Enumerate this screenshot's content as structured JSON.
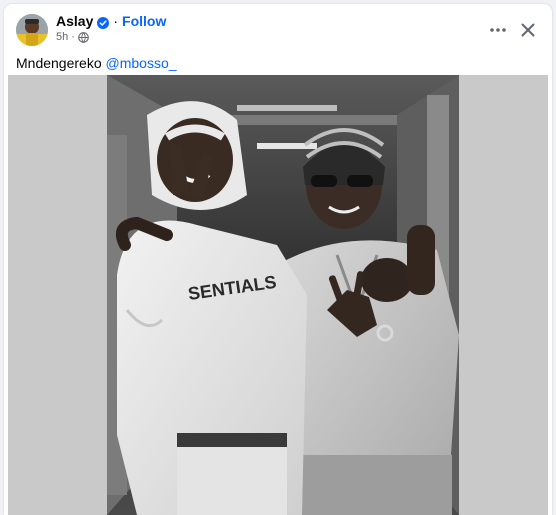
{
  "post": {
    "author": "Aslay",
    "follow_label": "Follow",
    "separator": "·",
    "timestamp": "5h",
    "meta_separator": "·",
    "caption_text": "Mndengereko ",
    "mention": "@mbosso_",
    "icons": {
      "verified": "verified-badge-icon",
      "privacy": "globe-icon",
      "more": "more-options-icon",
      "close": "close-icon"
    },
    "image_description_colors": {
      "accent": "#0866ff",
      "text": "#050505",
      "muted": "#65676b"
    }
  }
}
